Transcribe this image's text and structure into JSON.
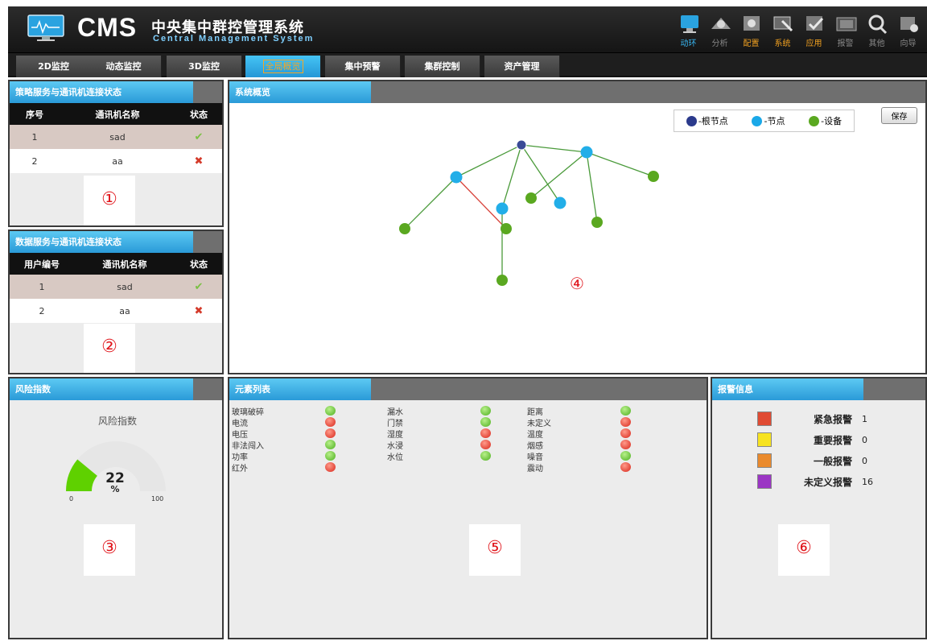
{
  "app": {
    "name": "CMS",
    "subtitle_cn": "中央集中群控管理系统",
    "subtitle_en": "Central Management System"
  },
  "toolbar": [
    {
      "label": "动环",
      "icon": "monitor-icon",
      "state": "active"
    },
    {
      "label": "分析",
      "icon": "analysis-icon",
      "state": "normal"
    },
    {
      "label": "配置",
      "icon": "config-icon",
      "state": "highlight"
    },
    {
      "label": "系统",
      "icon": "system-icon",
      "state": "highlight"
    },
    {
      "label": "应用",
      "icon": "application-icon",
      "state": "highlight"
    },
    {
      "label": "报警",
      "icon": "alarm-icon",
      "state": "normal"
    },
    {
      "label": "其他",
      "icon": "other-icon",
      "state": "normal"
    },
    {
      "label": "向导",
      "icon": "wizard-icon",
      "state": "normal"
    }
  ],
  "nav_tabs": [
    {
      "label": "2D监控",
      "active": false
    },
    {
      "label": "动态监控",
      "active": false
    },
    {
      "label": "3D监控",
      "active": false
    },
    {
      "label": "全局概览",
      "active": true
    },
    {
      "label": "集中预警",
      "active": false
    },
    {
      "label": "集群控制",
      "active": false
    },
    {
      "label": "资产管理",
      "active": false
    }
  ],
  "panel1": {
    "title": "策略服务与通讯机连接状态",
    "headers": [
      "序号",
      "通讯机名称",
      "状态"
    ],
    "rows": [
      {
        "id": "1",
        "name": "sad",
        "status": "ok"
      },
      {
        "id": "2",
        "name": "aa",
        "status": "error"
      }
    ],
    "badge": "①"
  },
  "panel2": {
    "title": "数据服务与通讯机连接状态",
    "headers": [
      "用户编号",
      "通讯机名称",
      "状态"
    ],
    "rows": [
      {
        "id": "1",
        "name": "sad",
        "status": "ok"
      },
      {
        "id": "2",
        "name": "aa",
        "status": "error"
      }
    ],
    "badge": "②"
  },
  "panel3": {
    "title": "风险指数",
    "gauge_title": "风险指数",
    "value": "22",
    "unit": "%",
    "min": "0",
    "max": "100",
    "fraction": 0.22,
    "badge": "③"
  },
  "panel4": {
    "title": "系统概览",
    "legend": [
      {
        "label": "-根节点",
        "color": "#2b3a8c"
      },
      {
        "label": "-节点",
        "color": "#1aa8e8"
      },
      {
        "label": "-设备",
        "color": "#5aa820"
      }
    ],
    "save_label": "保存",
    "badge": "④"
  },
  "panel5": {
    "title": "元素列表",
    "columns": [
      [
        {
          "name": "玻璃破碎",
          "status": "green"
        },
        {
          "name": "电流",
          "status": "red"
        },
        {
          "name": "电压",
          "status": "red"
        },
        {
          "name": "非法闯入",
          "status": "green"
        },
        {
          "name": "功率",
          "status": "green"
        },
        {
          "name": "红外",
          "status": "red"
        }
      ],
      [
        {
          "name": "漏水",
          "status": "green"
        },
        {
          "name": "门禁",
          "status": "green"
        },
        {
          "name": "湿度",
          "status": "red"
        },
        {
          "name": "水浸",
          "status": "red"
        },
        {
          "name": "水位",
          "status": "green"
        }
      ],
      [
        {
          "name": "距离",
          "status": "green"
        },
        {
          "name": "未定义",
          "status": "red"
        },
        {
          "name": "温度",
          "status": "red"
        },
        {
          "name": "烟感",
          "status": "red"
        },
        {
          "name": "噪音",
          "status": "green"
        },
        {
          "name": "震动",
          "status": "red"
        }
      ]
    ],
    "badge": "⑤"
  },
  "panel6": {
    "title": "报警信息",
    "items": [
      {
        "label": "紧急报警",
        "count": "1",
        "color": "#e04b33"
      },
      {
        "label": "重要报警",
        "count": "0",
        "color": "#f7e320"
      },
      {
        "label": "一般报警",
        "count": "0",
        "color": "#ea8a2c"
      },
      {
        "label": "未定义报警",
        "count": "16",
        "color": "#9b36c4"
      }
    ],
    "badge": "⑥"
  },
  "colors": {
    "accent_blue": "#2a9ad8",
    "status_green": "#5dbd3c",
    "status_red": "#e0392a",
    "active_tab_text": "#f5a623"
  }
}
